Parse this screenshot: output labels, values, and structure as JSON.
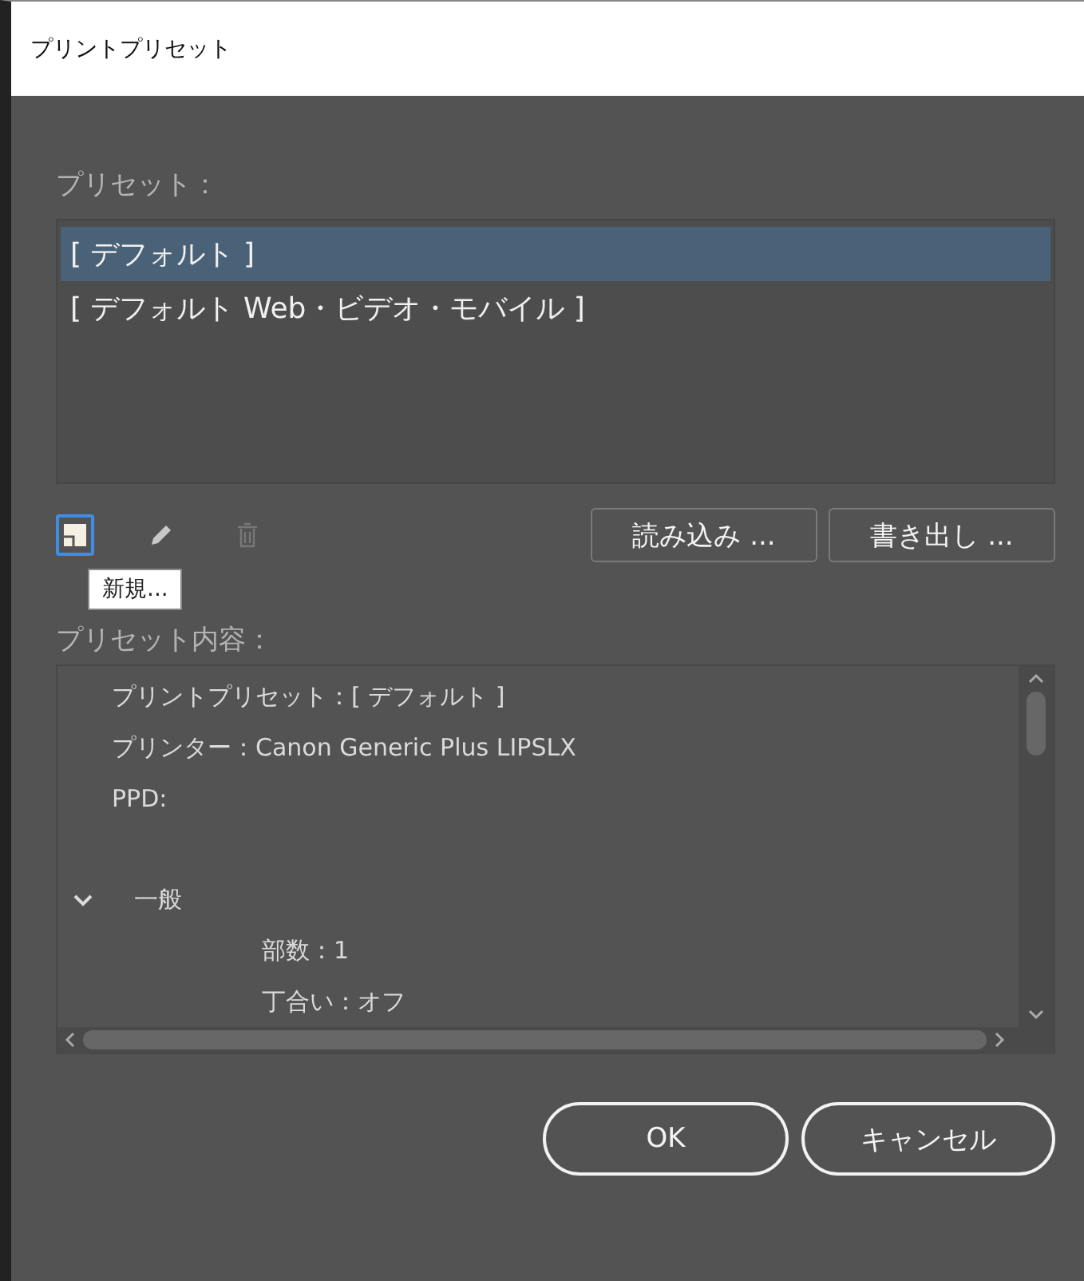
{
  "window": {
    "title": "プリントプリセット"
  },
  "presets": {
    "label": "プリセット：",
    "items": [
      {
        "label": "[ デフォルト ]",
        "selected": true
      },
      {
        "label": "[ デフォルト Web・ビデオ・モバイル ]",
        "selected": false
      }
    ]
  },
  "toolbar": {
    "tools": [
      {
        "kind": "new",
        "selected": true,
        "disabled": false
      },
      {
        "kind": "edit",
        "selected": false,
        "disabled": false
      },
      {
        "kind": "delete",
        "selected": false,
        "disabled": true
      }
    ],
    "buttons": [
      "読み込み ...",
      "書き出し ..."
    ]
  },
  "tooltip": "新規...",
  "contents": {
    "label": "プリセット内容：",
    "items": [
      {
        "kind": "line",
        "text": "プリントプリセット：[ デフォルト ]"
      },
      {
        "kind": "line",
        "text": "プリンター：Canon Generic Plus LIPSLX"
      },
      {
        "kind": "line",
        "text": "PPD:"
      },
      {
        "kind": "blank"
      },
      {
        "kind": "group",
        "text": "一般",
        "expanded": true,
        "children": [
          {
            "kind": "line",
            "text": "部数：1"
          },
          {
            "kind": "line",
            "text": "丁合い：オフ"
          }
        ]
      }
    ]
  },
  "buttons": [
    "OK",
    "キャンセル"
  ]
}
